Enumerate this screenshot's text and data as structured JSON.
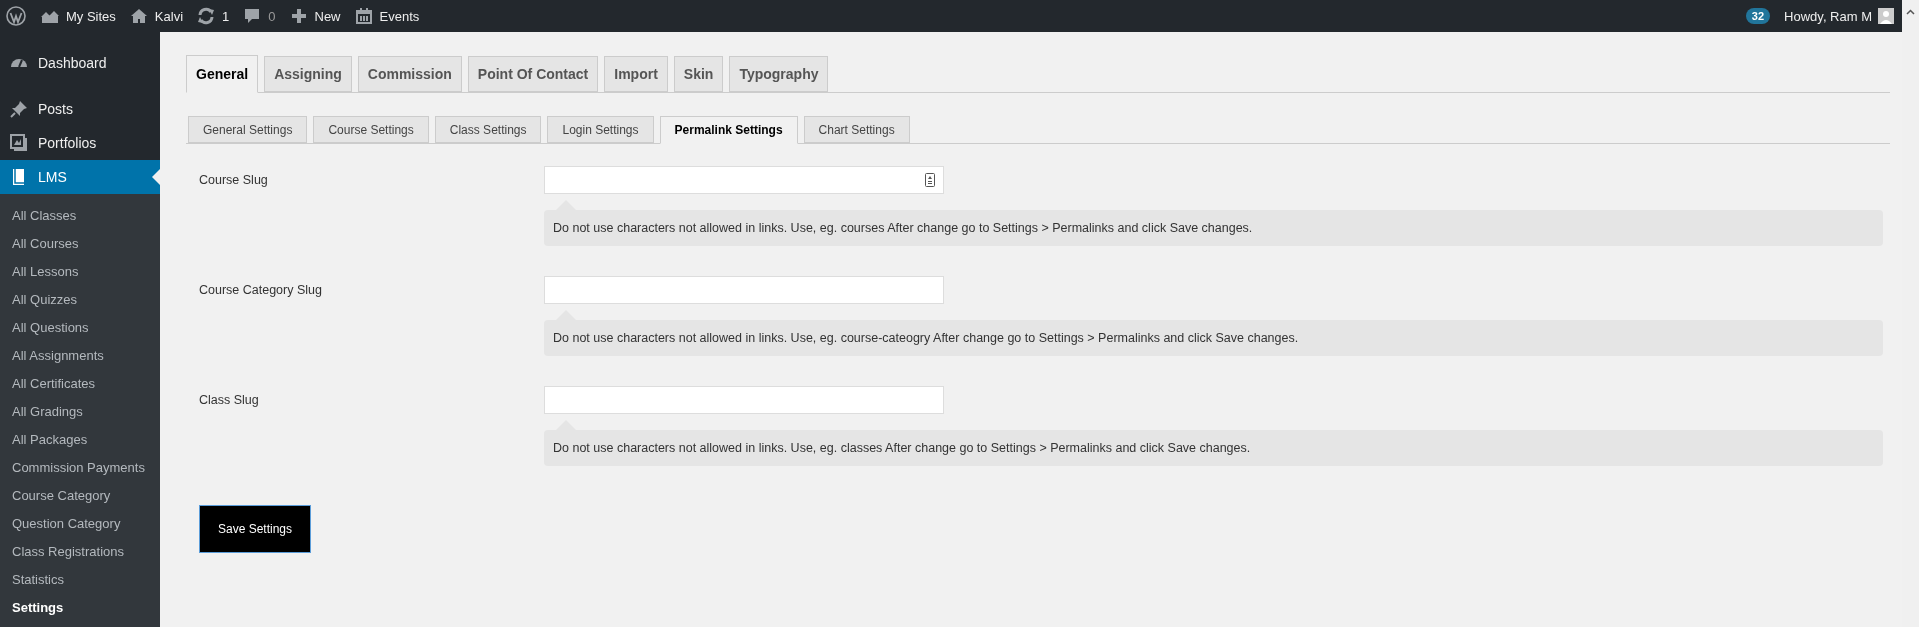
{
  "top_bar": {
    "items": [
      {
        "kind": "logo"
      },
      {
        "kind": "sites",
        "label": "My Sites"
      },
      {
        "kind": "home",
        "label": "Kalvi"
      },
      {
        "kind": "updates",
        "label": "1"
      },
      {
        "kind": "comments",
        "label": "0"
      },
      {
        "kind": "new",
        "label": "New"
      },
      {
        "kind": "events",
        "label": "Events"
      }
    ],
    "notifications": "32",
    "greeting": "Howdy, Ram M"
  },
  "sidebar": {
    "items": [
      {
        "label": "Dashboard",
        "selected": false
      },
      {
        "label": "Posts",
        "selected": false
      },
      {
        "label": "Portfolios",
        "selected": false
      },
      {
        "label": "LMS",
        "selected": true,
        "children": [
          {
            "label": "All Classes",
            "selected": false
          },
          {
            "label": "All Courses",
            "selected": false
          },
          {
            "label": "All Lessons",
            "selected": false
          },
          {
            "label": "All Quizzes",
            "selected": false
          },
          {
            "label": "All Questions",
            "selected": false
          },
          {
            "label": "All Assignments",
            "selected": false
          },
          {
            "label": "All Certificates",
            "selected": false
          },
          {
            "label": "All Gradings",
            "selected": false
          },
          {
            "label": "All Packages",
            "selected": false
          },
          {
            "label": "Commission Payments",
            "selected": false
          },
          {
            "label": "Course Category",
            "selected": false
          },
          {
            "label": "Question Category",
            "selected": false
          },
          {
            "label": "Class Registrations",
            "selected": false
          },
          {
            "label": "Statistics",
            "selected": false
          },
          {
            "label": "Settings",
            "selected": true
          }
        ]
      }
    ]
  },
  "tabs": [
    {
      "label": "General",
      "selected": true
    },
    {
      "label": "Assigning",
      "selected": false
    },
    {
      "label": "Commission",
      "selected": false
    },
    {
      "label": "Point Of Contact",
      "selected": false
    },
    {
      "label": "Import",
      "selected": false
    },
    {
      "label": "Skin",
      "selected": false
    },
    {
      "label": "Typography",
      "selected": false
    }
  ],
  "sub_tabs": [
    {
      "label": "General Settings",
      "selected": false
    },
    {
      "label": "Course Settings",
      "selected": false
    },
    {
      "label": "Class Settings",
      "selected": false
    },
    {
      "label": "Login Settings",
      "selected": false
    },
    {
      "label": "Permalink Settings",
      "selected": true
    },
    {
      "label": "Chart Settings",
      "selected": false
    }
  ],
  "fields": [
    {
      "label": "Course Slug",
      "autofill_icon": true,
      "help": "Do not use characters not allowed in links. Use, eg. courses After change go to Settings > Permalinks and click Save changes."
    },
    {
      "label": "Course Category Slug",
      "autofill_icon": false,
      "help": "Do not use characters not allowed in links. Use, eg. course-cateogry After change go to Settings > Permalinks and click Save changes."
    },
    {
      "label": "Class Slug",
      "autofill_icon": false,
      "help": "Do not use characters not allowed in links. Use, eg. classes After change go to Settings > Permalinks and click Save changes."
    }
  ],
  "save_button": "Save Settings"
}
